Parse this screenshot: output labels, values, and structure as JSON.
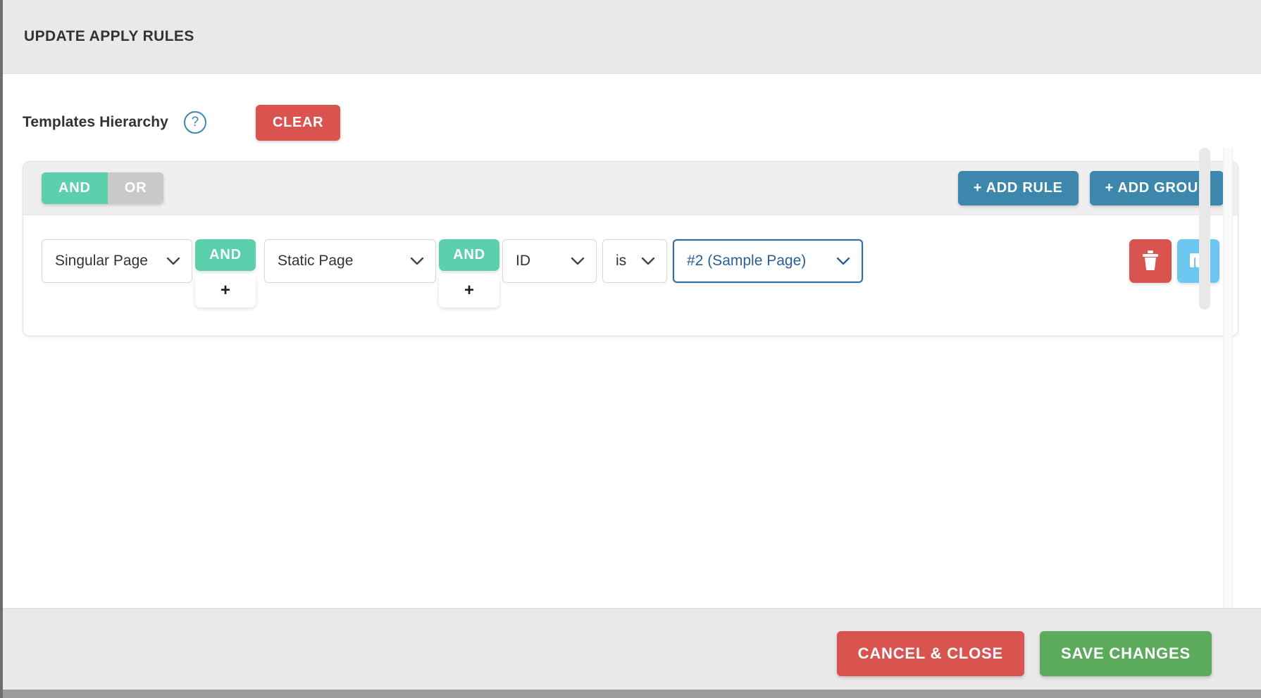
{
  "modal": {
    "title": "UPDATE APPLY RULES"
  },
  "hierarchy": {
    "label": "Templates Hierarchy",
    "help_icon": "question-circle-icon",
    "help_glyph": "?",
    "clear_label": "CLEAR"
  },
  "group": {
    "conjunction": {
      "and_label": "AND",
      "or_label": "OR",
      "selected": "AND"
    },
    "add_rule_label": "+ ADD RULE",
    "add_group_label": "+ ADD GROUP"
  },
  "rule": {
    "field_1": {
      "value": "Singular Page",
      "icon": "chevron-down-icon"
    },
    "conj_1": {
      "label": "AND",
      "plus_label": "+"
    },
    "field_2": {
      "value": "Static Page",
      "icon": "chevron-down-icon"
    },
    "conj_2": {
      "label": "AND",
      "plus_label": "+"
    },
    "field_3": {
      "value": "ID",
      "icon": "chevron-down-icon"
    },
    "operator": {
      "value": "is",
      "icon": "chevron-down-icon"
    },
    "value_select": {
      "value": "#2 (Sample Page)",
      "icon": "chevron-down-icon",
      "focused": true
    },
    "tools": {
      "delete_icon": "trash-icon",
      "copy_icon": "duplicate-icon"
    }
  },
  "footer": {
    "cancel_label": "CANCEL & CLOSE",
    "save_label": "SAVE CHANGES"
  },
  "colors": {
    "green_accent": "#5ccfad",
    "blue_accent": "#3d87ad",
    "red_accent": "#d9534f",
    "save_green": "#5cab5c",
    "copy_blue": "#6bc7ef",
    "focus_blue": "#2f6da3",
    "header_bg": "#e9e9e9"
  }
}
